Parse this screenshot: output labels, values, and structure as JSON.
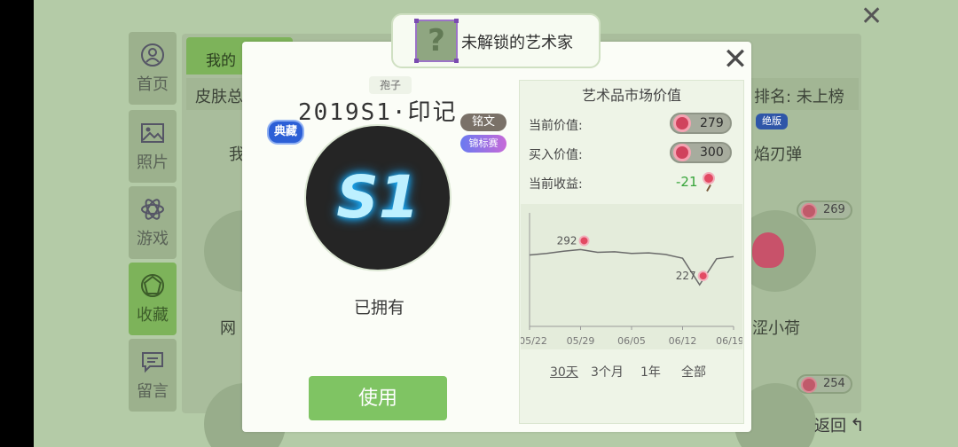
{
  "background": {
    "tab_label": "我的",
    "row_left": "皮肤总",
    "row_right": "排名: 未上榜",
    "items": [
      {
        "text": "我",
        "badge": null
      },
      {
        "text": "焰刃弹",
        "badge": "绝版"
      },
      {
        "text": "网",
        "badge": null
      },
      {
        "text": "涩小荷",
        "badge": "269"
      }
    ],
    "badge_254": "254",
    "back_label": "返回"
  },
  "sidebar": {
    "items": [
      {
        "label": "首页",
        "icon": "user-circle-icon"
      },
      {
        "label": "照片",
        "icon": "image-icon"
      },
      {
        "label": "游戏",
        "icon": "atom-icon"
      },
      {
        "label": "收藏",
        "icon": "gem-icon",
        "active": true
      },
      {
        "label": "留言",
        "icon": "message-icon"
      }
    ]
  },
  "artist": {
    "label": "未解锁的艺术家",
    "placeholder": "?"
  },
  "item": {
    "spore_tag": "孢子",
    "title": "2019S1·印记",
    "badge_dian": "典藏",
    "badge_ming": "铭文",
    "badge_jin": "锦标赛",
    "art_text": "S1",
    "owned_label": "已拥有",
    "use_button": "使用"
  },
  "market": {
    "title": "艺术品市场价值",
    "current_price_label": "当前价值:",
    "current_price": "279",
    "buy_price_label": "买入价值:",
    "buy_price": "300",
    "profit_label": "当前收益:",
    "profit": "-21",
    "periods": [
      "30天",
      "3个月",
      "1年",
      "全部"
    ],
    "active_period": "30天"
  },
  "chart_data": {
    "type": "line",
    "x": [
      "05/22",
      "05/24",
      "05/26",
      "05/29",
      "06/01",
      "06/03",
      "06/05",
      "06/08",
      "06/10",
      "06/12",
      "06/14",
      "06/16",
      "06/19"
    ],
    "x_ticks": [
      "05/22",
      "05/29",
      "06/05",
      "06/12",
      "06/19"
    ],
    "series": [
      {
        "values": [
          282,
          285,
          289,
          292,
          287,
          288,
          285,
          286,
          283,
          276,
          227,
          275,
          279
        ]
      }
    ],
    "annotations": [
      {
        "x": "05/29",
        "y": 292,
        "text": "292"
      },
      {
        "x": "06/14",
        "y": 227,
        "text": "227"
      }
    ],
    "line_color": "#6b6b6b",
    "grid": false
  },
  "colors": {
    "accent_green": "#7fc463",
    "profit_green": "#36a43a",
    "candy": "#d0425d",
    "art_glow": "#18b4ff"
  }
}
